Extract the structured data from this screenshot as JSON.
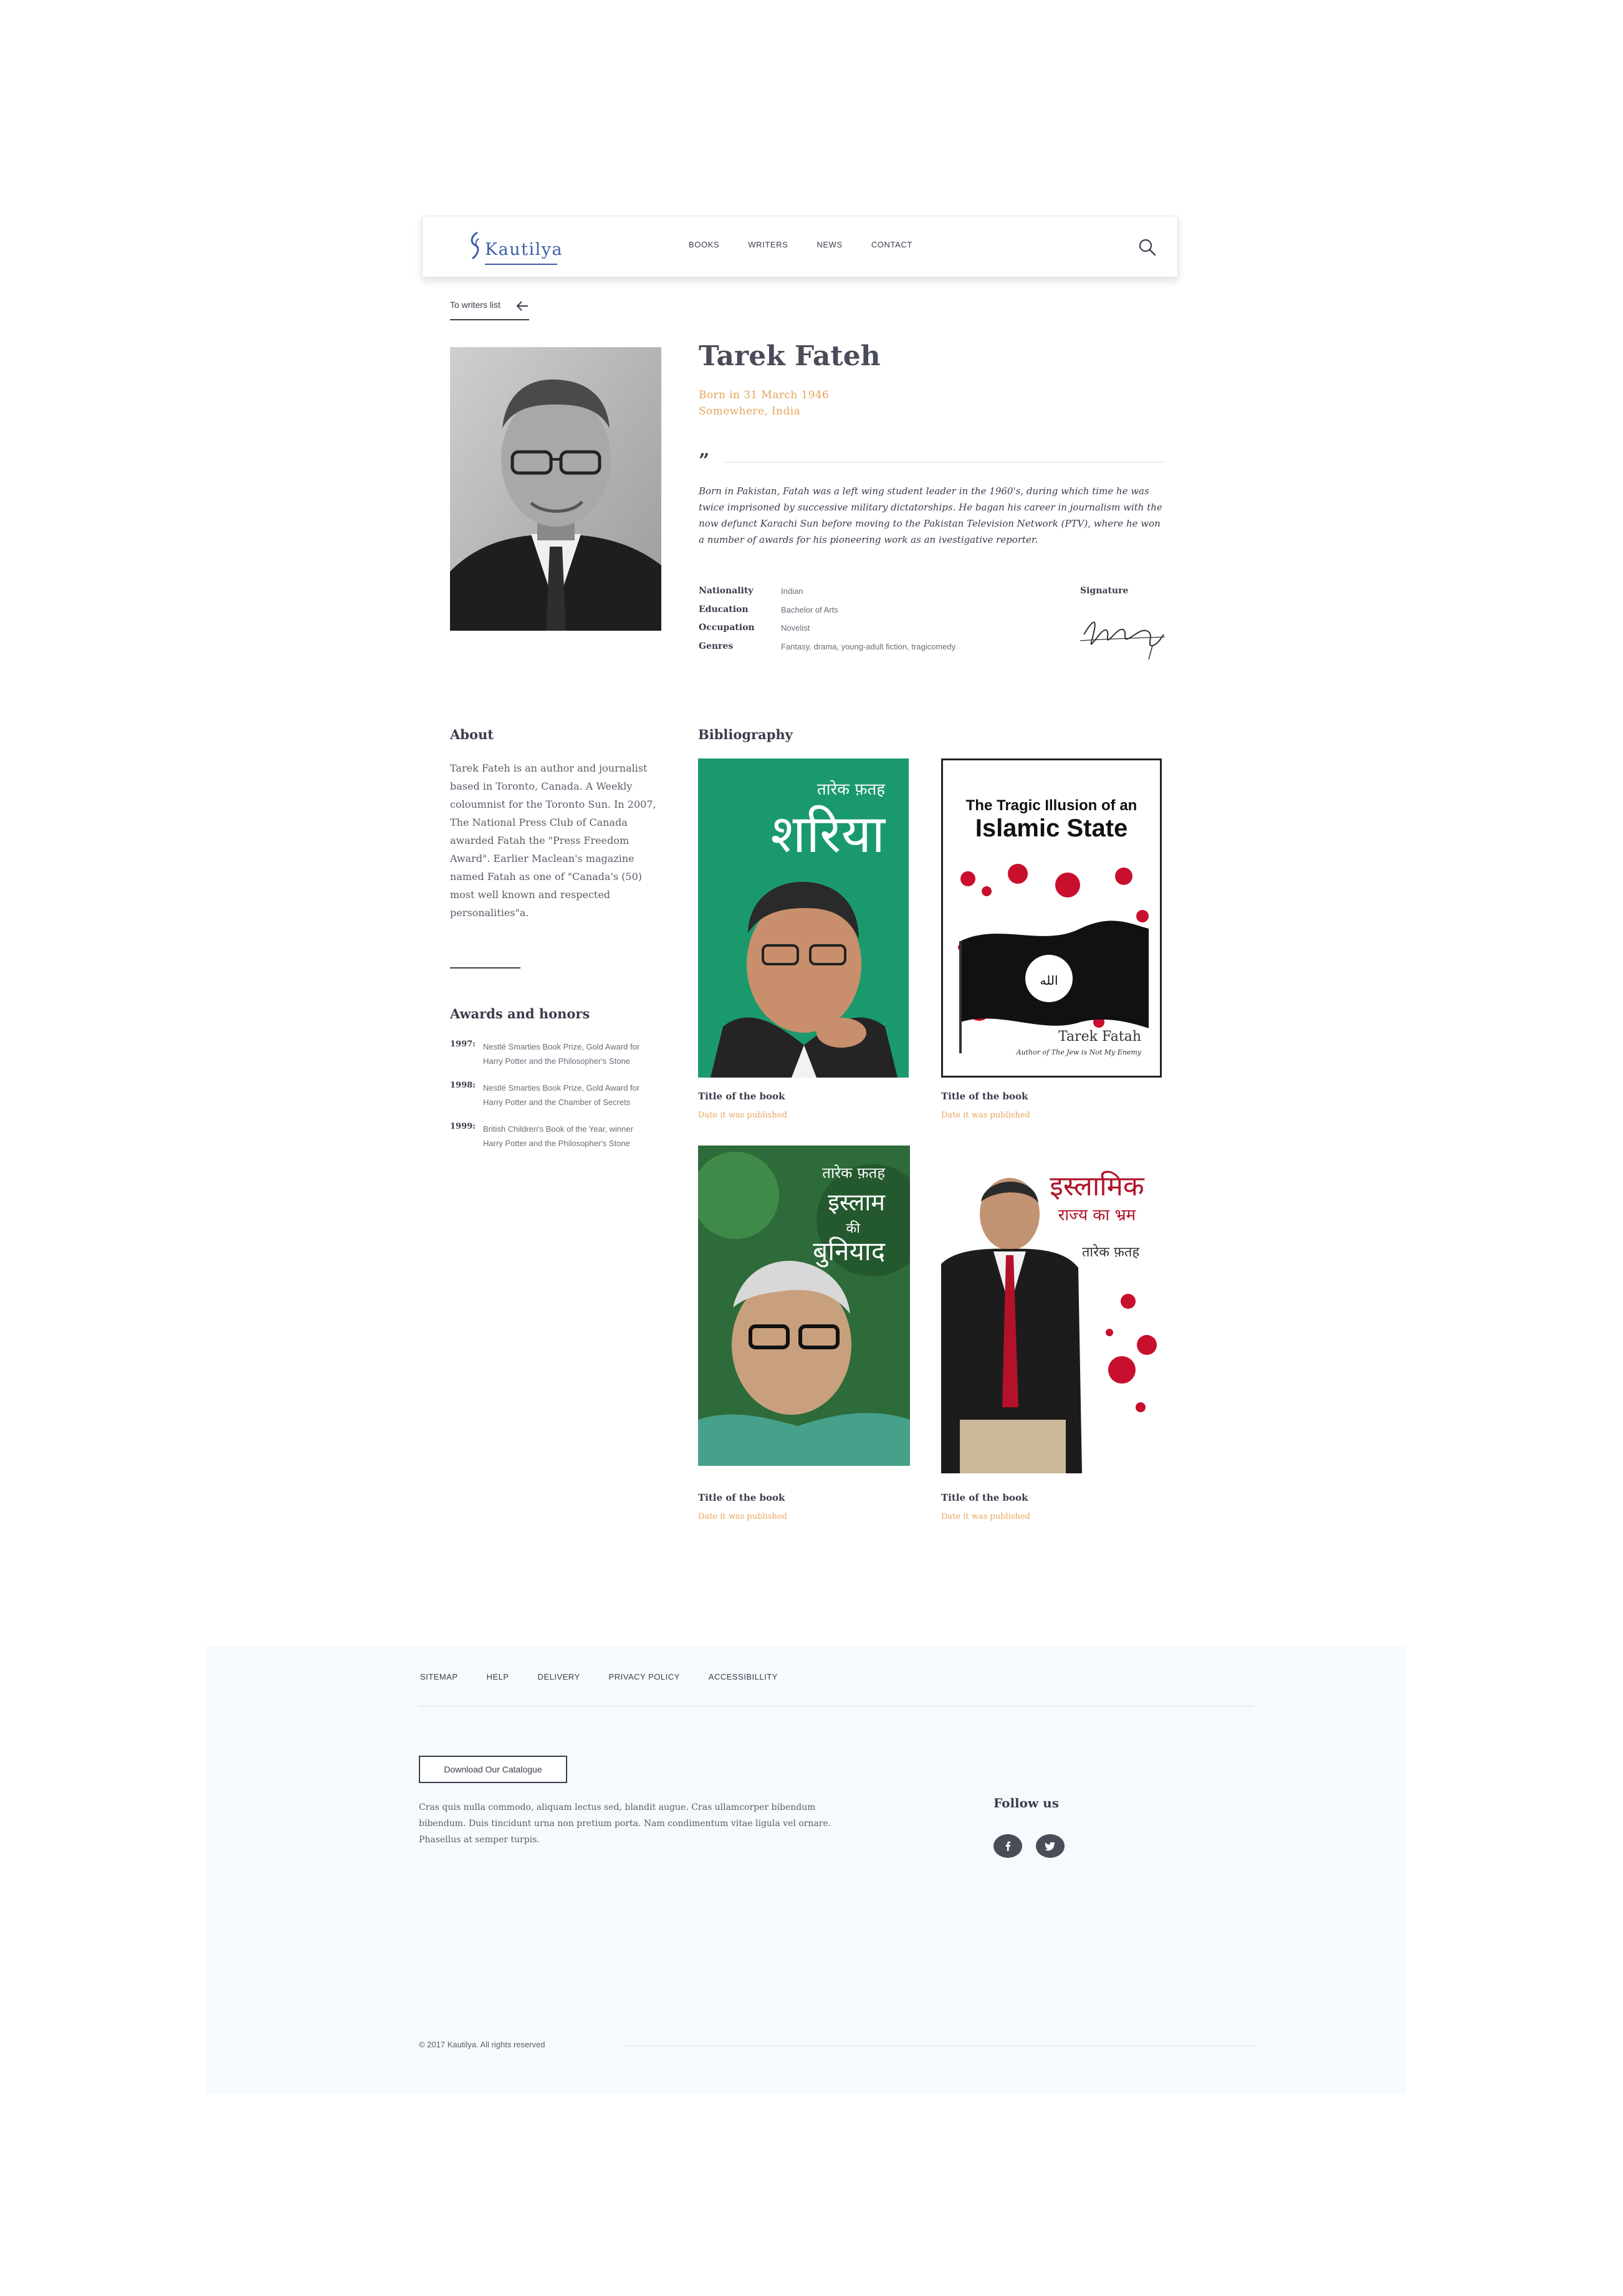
{
  "header": {
    "logo_text": "Kautilya",
    "nav": [
      "BOOKS",
      "WRITERS",
      "NEWS",
      "CONTACT"
    ]
  },
  "back_link": "To writers list",
  "author": {
    "name": "Tarek Fateh",
    "born": "Born in 31 March 1946",
    "place": "Somewhere, India",
    "quote": "Born in Pakistan, Fatah was a left wing student leader in the 1960's, during which time he was twice imprisoned by successive military dictatorships. He bagan his career in journalism with the now defunct Karachi Sun before moving to the Pakistan Television Network (PTV), where he won a number of awards for his pioneering work as an ivestigative reporter.",
    "facts": [
      {
        "label": "Nationality",
        "value": "Indian"
      },
      {
        "label": "Education",
        "value": "Bachelor of Arts"
      },
      {
        "label": "Occupation",
        "value": "Novelist"
      },
      {
        "label": "Genres",
        "value": "Fantasy, drama, young-adult fiction, tragicomedy"
      }
    ],
    "signature_title": "Signature"
  },
  "about": {
    "heading": "About",
    "text": "Tarek Fateh is an author and journalist based in Toronto, Canada. A Weekly coloumnist for the Toronto Sun. In 2007, The National Press Club of Canada awarded Fatah the \"Press Freedom Award\". Earlier Maclean's magazine named Fatah as one of \"Canada's (50) most well known and respected personalities\"a."
  },
  "awards": {
    "heading": "Awards and honors",
    "items": [
      {
        "year": "1997:",
        "text": "Nestlé Smarties Book Prize, Gold Award for Harry Potter and the Philosopher's Stone"
      },
      {
        "year": "1998:",
        "text": "Nestlé Smarties Book Prize, Gold Award for Harry Potter and the Chamber of Secrets"
      },
      {
        "year": "1999:",
        "text": "British Children's Book of the Year, winner Harry Potter and the Philosopher's Stone"
      }
    ]
  },
  "bibliography": {
    "heading": "Bibliography",
    "books": [
      {
        "title": "Title of the book",
        "date": "Date it was published",
        "cover_top": "तारेक फ़तह",
        "cover_title": "शरिया"
      },
      {
        "title": "Title of the book",
        "date": "Date it was published",
        "cover_title": "The Tragic Illusion of an",
        "cover_title2": "Islamic State",
        "cover_author": "Tarek Fatah",
        "cover_sub": "Author of The Jew is Not My Enemy"
      },
      {
        "title": "Title of the book",
        "date": "Date it was published",
        "cover_top": "तारेक फ़तह",
        "cover_title": "इस्लाम",
        "cover_title2": "की",
        "cover_title3": "बुनियाद"
      },
      {
        "title": "Title of the book",
        "date": "Date it was published",
        "cover_title": "इस्लामिक",
        "cover_title2": "राज्य का भ्रम",
        "cover_author": "तारेक फ़तह"
      }
    ]
  },
  "footer": {
    "links": [
      "SITEMAP",
      "HELP",
      "DELIVERY",
      "PRIVACY POLICY",
      "ACCESSIBILLITY"
    ],
    "catalogue_button": "Download Our Catalogue",
    "text": "Cras quis nulla commodo, aliquam lectus sed, blandit augue. Cras ullamcorper bibendum bibendum. Duis tincidunt urna non pretium porta. Nam condimentum vitae ligula vel ornare. Phasellus at semper turpis.",
    "follow_heading": "Follow us",
    "copyright": "© 2017 Kautilya. All rights reserved"
  },
  "colors": {
    "accent": "#e8a45a",
    "logo": "#3b5ea8",
    "text": "#3a3d4a",
    "footer_bg": "#f4fafd",
    "book1_bg": "#1a9a6c"
  },
  "icons": [
    "search-icon",
    "arrow-left-icon",
    "facebook-icon",
    "twitter-icon"
  ]
}
